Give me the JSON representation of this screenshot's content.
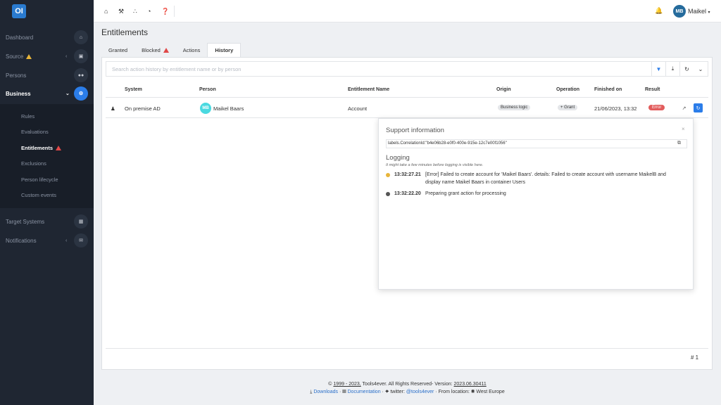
{
  "sidebar": {
    "logo_text": "OI",
    "items": [
      {
        "label": "Dashboard"
      },
      {
        "label": "Source"
      },
      {
        "label": "Persons"
      },
      {
        "label": "Business"
      },
      {
        "label": "Target Systems"
      },
      {
        "label": "Notifications"
      }
    ],
    "submenu": [
      {
        "label": "Rules"
      },
      {
        "label": "Evaluations"
      },
      {
        "label": "Entitlements"
      },
      {
        "label": "Exclusions"
      },
      {
        "label": "Person lifecycle"
      },
      {
        "label": "Custom events"
      }
    ]
  },
  "topbar": {
    "user_initials": "MB",
    "user_name": "Maikel"
  },
  "page": {
    "title": "Entitlements",
    "tabs": [
      {
        "label": "Granted"
      },
      {
        "label": "Blocked"
      },
      {
        "label": "Actions"
      },
      {
        "label": "History"
      }
    ],
    "search_placeholder": "Search action history by entitlement name or by person",
    "columns": {
      "system": "System",
      "person": "Person",
      "entitlement": "Entitlement Name",
      "origin": "Origin",
      "operation": "Operation",
      "finished": "Finished on",
      "result": "Result"
    },
    "row": {
      "system": "On premise AD",
      "person_initials": "MB",
      "person": "Maikel Baars",
      "entitlement": "Account",
      "origin": "Business logic",
      "operation": "+ Grant",
      "finished": "21/06/2023, 13:32",
      "result": "Error"
    },
    "count": "# 1"
  },
  "popup": {
    "title": "Support information",
    "close": "×",
    "correlation": "labels.CorrelationId:\"b4e06b28-e0f0-400e-915e-12c7e00f1056\"",
    "logging_title": "Logging",
    "logging_note": "It might take a few minutes before logging is visible here.",
    "logs": [
      {
        "time": "13:32:27.21",
        "message": "[Error] Failed to create account for 'Maikel Baars'. details: Failed to create account with username MaikelB and display name Maikel Baars in container Users"
      },
      {
        "time": "13:32:22.20",
        "message": "Preparing grant action for processing"
      }
    ]
  },
  "footer": {
    "copyright_prefix": "©",
    "years": "1999 - 2023,",
    "company": "Tools4ever. All Rights Reserved- Version:",
    "version": "2023.06.30411",
    "downloads": "Downloads",
    "documentation": "Documentation",
    "twitter_label": "twitter:",
    "twitter_handle": "@tools4ever",
    "location_label": "From location:",
    "location": "West Europe"
  }
}
